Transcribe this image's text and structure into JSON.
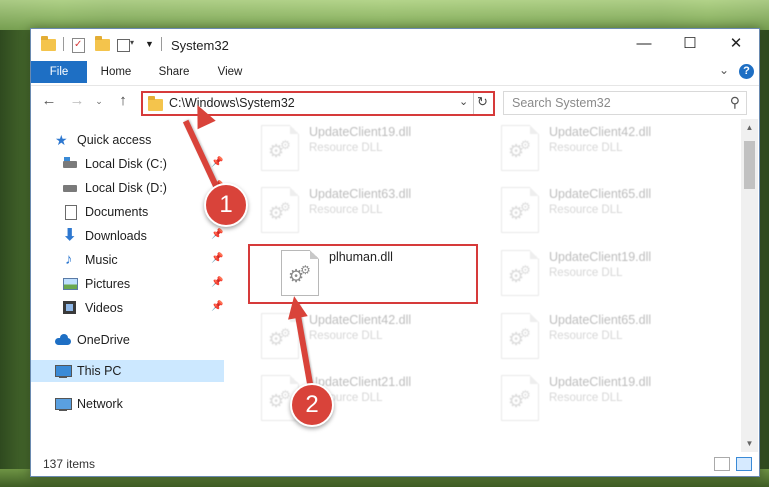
{
  "window": {
    "title": "System32"
  },
  "ribbon": {
    "tabs": [
      "File",
      "Home",
      "Share",
      "View"
    ],
    "help": "?"
  },
  "address": {
    "path": "C:\\Windows\\System32"
  },
  "search": {
    "placeholder": "Search System32"
  },
  "nav": {
    "items": [
      {
        "label": "Quick access"
      },
      {
        "label": "Local Disk (C:)"
      },
      {
        "label": "Local Disk (D:)"
      },
      {
        "label": "Documents"
      },
      {
        "label": "Downloads"
      },
      {
        "label": "Music"
      },
      {
        "label": "Pictures"
      },
      {
        "label": "Videos"
      },
      {
        "label": "OneDrive"
      },
      {
        "label": "This PC"
      },
      {
        "label": "Network"
      }
    ]
  },
  "files": [
    {
      "name": "UpdateClient19.dll",
      "type": "Resource DLL"
    },
    {
      "name": "UpdateClient42.dll",
      "type": "Resource DLL"
    },
    {
      "name": "UpdateClient63.dll",
      "type": "Resource DLL"
    },
    {
      "name": "UpdateClient65.dll",
      "type": "Resource DLL"
    },
    {
      "name": "plhuman.dll",
      "type": ""
    },
    {
      "name": "UpdateClient19.dll",
      "type": "Resource DLL"
    },
    {
      "name": "UpdateClient42.dll",
      "type": "Resource DLL"
    },
    {
      "name": "UpdateClient65.dll",
      "type": "Resource DLL"
    },
    {
      "name": "UpdateClient21.dll",
      "type": "Resource DLL"
    },
    {
      "name": "UpdateClient19.dll",
      "type": "Resource DLL"
    }
  ],
  "status": {
    "count": "137 items"
  },
  "callouts": {
    "one": "1",
    "two": "2"
  },
  "colors": {
    "accent": "#1e6fc4",
    "highlight": "#d63a3a",
    "selected": "#cce8ff"
  }
}
